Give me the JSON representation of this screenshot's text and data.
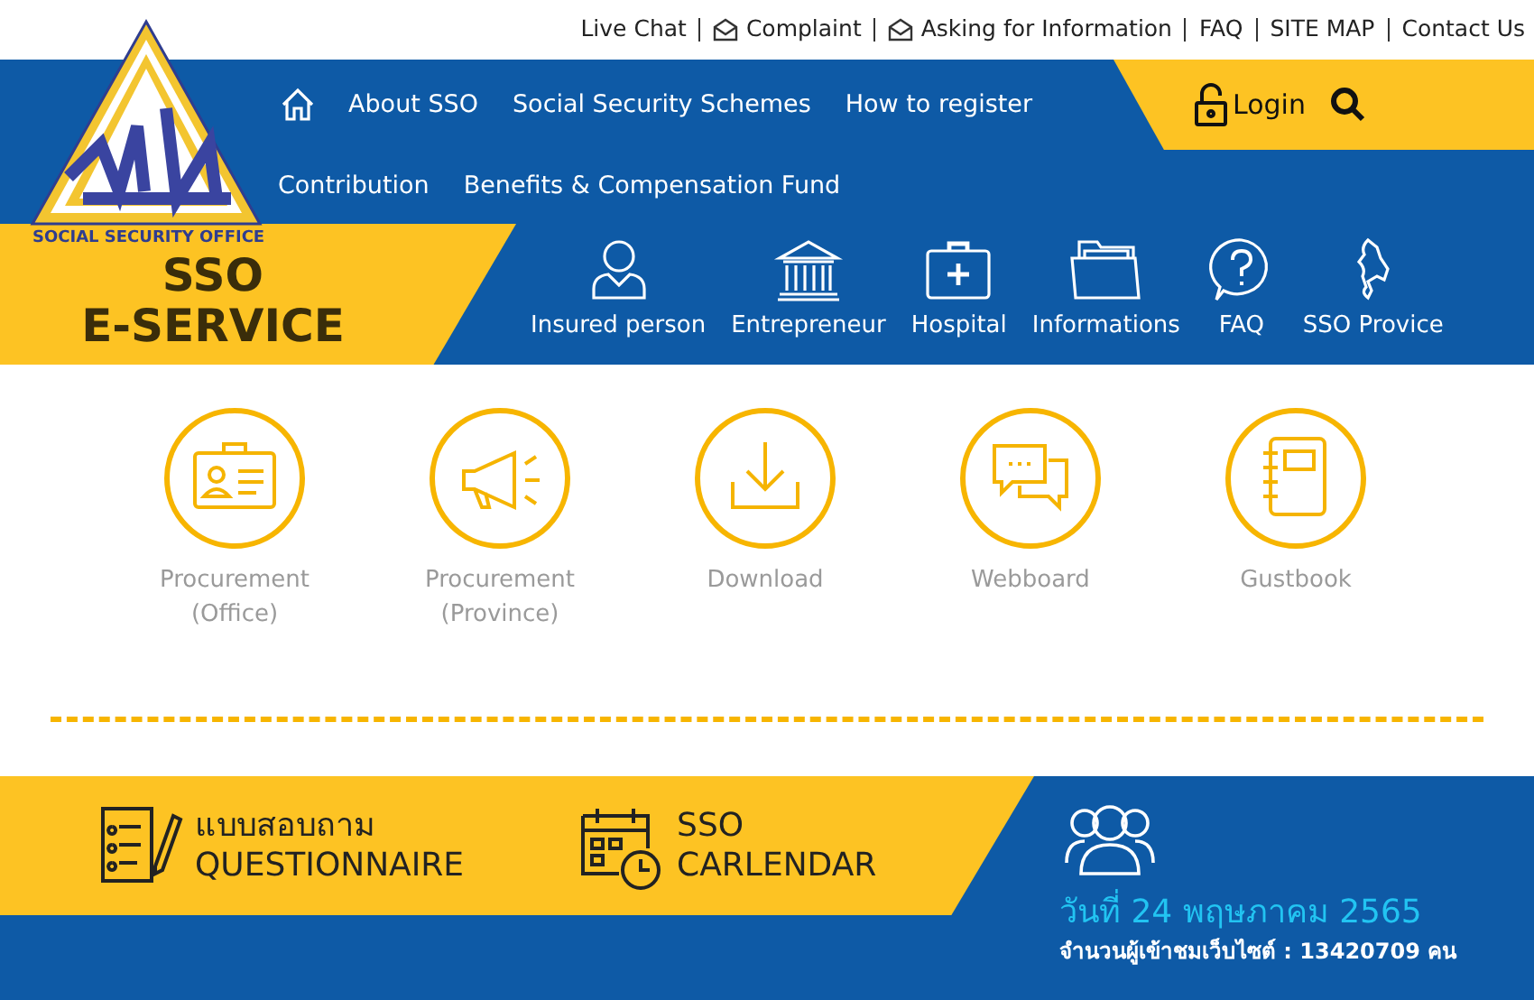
{
  "top_links": [
    {
      "label": "Live Chat",
      "kind": "plain"
    },
    {
      "label": "Complaint",
      "kind": "mail"
    },
    {
      "label": "Asking for Information",
      "kind": "mail"
    },
    {
      "label": "FAQ",
      "kind": "plain"
    },
    {
      "label": "SITE MAP",
      "kind": "plain"
    },
    {
      "label": "Contact Us",
      "kind": "plain"
    }
  ],
  "brand": {
    "org": "SOCIAL SECURITY OFFICE",
    "line1": "SSO",
    "line2": "E-SERVICE"
  },
  "nav_primary": [
    "About SSO",
    "Social Security Schemes",
    "How to register"
  ],
  "nav_secondary": [
    "Contribution",
    "Benefits & Compensation Fund"
  ],
  "login": {
    "label": "Login"
  },
  "categories": [
    {
      "label": "Insured person",
      "kind": "person"
    },
    {
      "label": "Entrepreneur",
      "kind": "building"
    },
    {
      "label": "Hospital",
      "kind": "medkit"
    },
    {
      "label": "Informations",
      "kind": "folder"
    },
    {
      "label": "FAQ",
      "kind": "question"
    },
    {
      "label": "SSO Provice",
      "kind": "map"
    }
  ],
  "services": [
    {
      "lines": [
        "Procurement",
        "(Office)"
      ],
      "kind": "id-card"
    },
    {
      "lines": [
        "Procurement",
        "(Province)"
      ],
      "kind": "megaphone"
    },
    {
      "lines": [
        "Download"
      ],
      "kind": "download"
    },
    {
      "lines": [
        "Webboard"
      ],
      "kind": "chat"
    },
    {
      "lines": [
        "Gustbook"
      ],
      "kind": "notebook"
    }
  ],
  "promos": [
    {
      "line1": "แบบสอบถาม",
      "line2": "QUESTIONNAIRE",
      "kind": "form"
    },
    {
      "line1": "SSO",
      "line2": "CARLENDAR",
      "kind": "calendar"
    }
  ],
  "date": "วันที่ 24 พฤษภาคม 2565",
  "visitors": "จำนวนผู้เข้าชมเว็บไซต์ : 13420709 คน"
}
